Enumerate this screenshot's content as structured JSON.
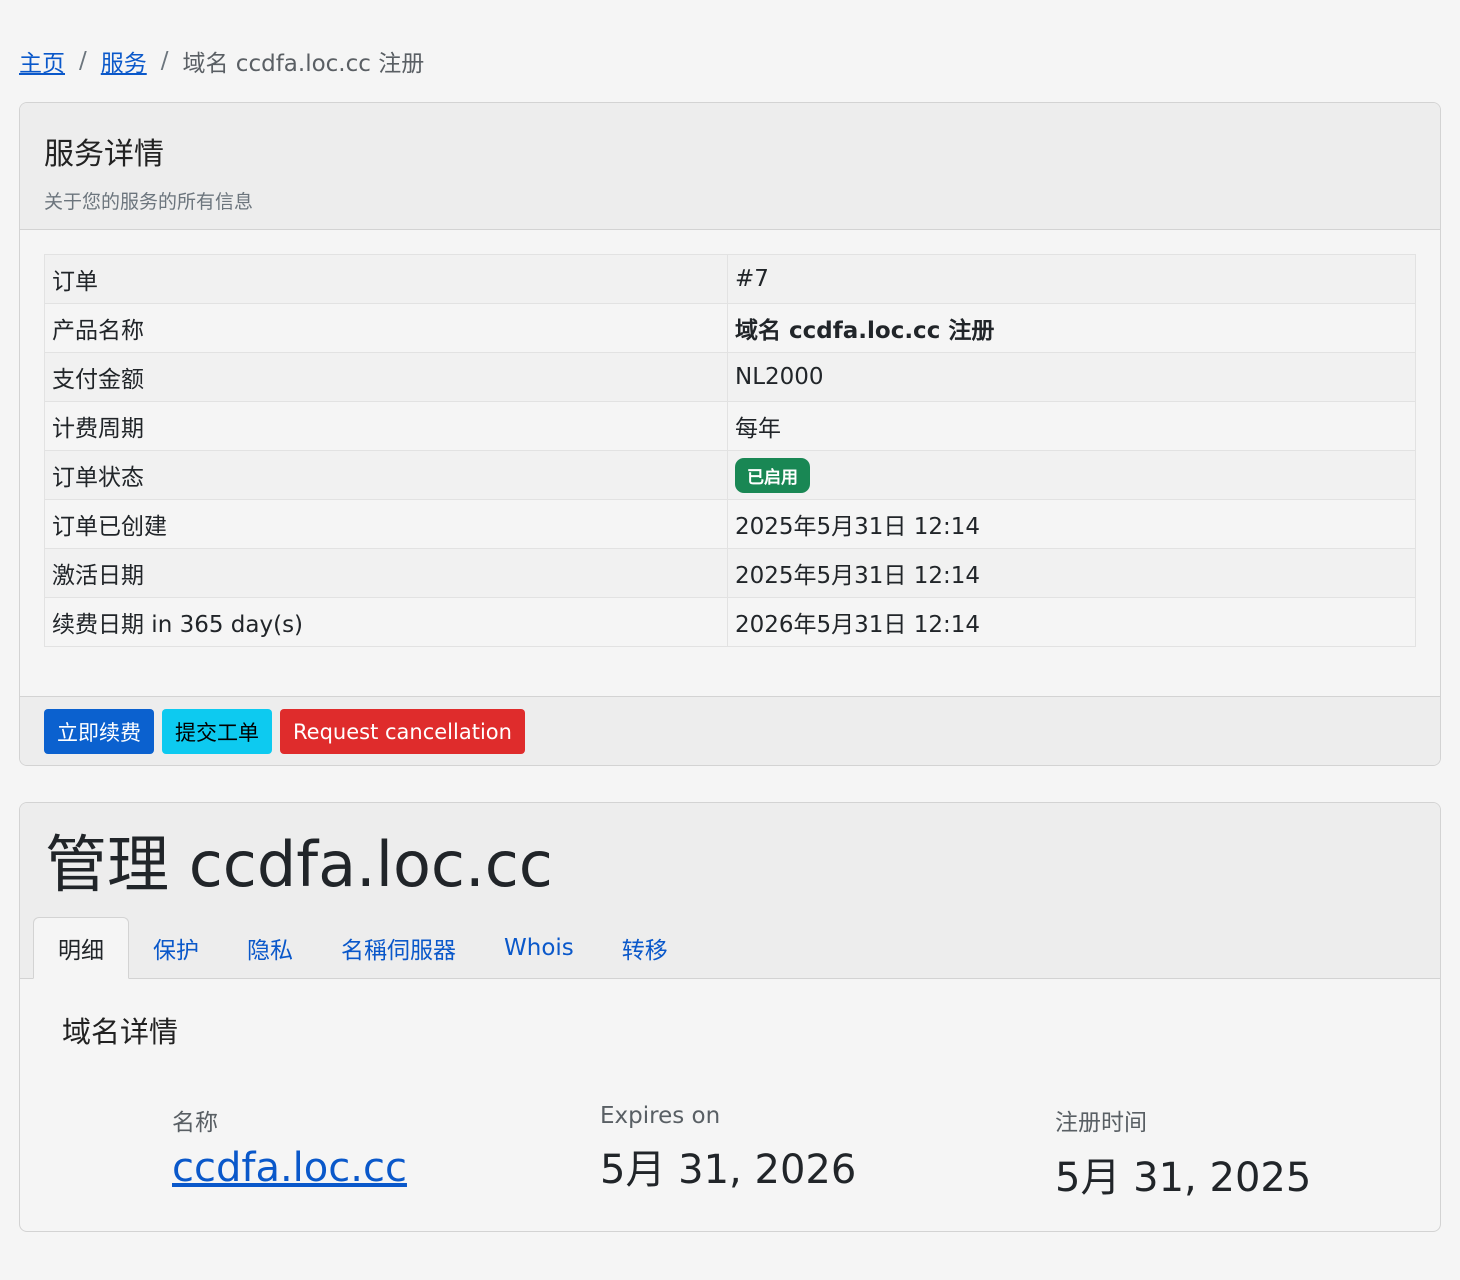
{
  "breadcrumb": {
    "home": "主页",
    "services": "服务",
    "current": "域名 ccdfa.loc.cc 注册",
    "separator": "/"
  },
  "service_details": {
    "title": "服务详情",
    "subtitle": "关于您的服务的所有信息",
    "rows": [
      {
        "key": "订单",
        "value": "#7"
      },
      {
        "key": "产品名称",
        "value": "域名 ccdfa.loc.cc 注册"
      },
      {
        "key": "支付金额",
        "value": "NL2000"
      },
      {
        "key": "计费周期",
        "value": "每年"
      },
      {
        "key": "订单状态",
        "value": "已启用"
      },
      {
        "key": "订单已创建",
        "value": "2025年5月31日 12:14"
      },
      {
        "key": "激活日期",
        "value": "2025年5月31日 12:14"
      },
      {
        "key": "续费日期 in 365 day(s)",
        "value": "2026年5月31日 12:14"
      }
    ],
    "status_color": "#198754",
    "buttons": {
      "renew": "立即续费",
      "ticket": "提交工单",
      "cancel": "Request cancellation"
    }
  },
  "manage": {
    "title": "管理 ccdfa.loc.cc",
    "tabs": [
      "明细",
      "保护",
      "隐私",
      "名稱伺服器",
      "Whois",
      "转移"
    ],
    "active_tab": "明细",
    "section_title": "域名详情",
    "name_label": "名称",
    "name_value": "ccdfa.loc.cc",
    "expires_label": "Expires on",
    "expires_value": "5月 31, 2026",
    "registered_label": "注册时间",
    "registered_value": "5月 31, 2025"
  }
}
